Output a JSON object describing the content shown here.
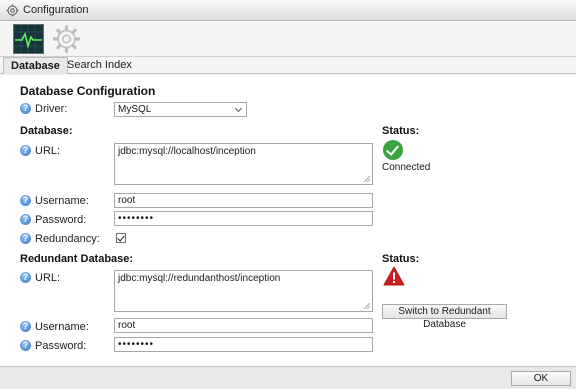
{
  "window": {
    "title": "Configuration"
  },
  "toolbar": {
    "buttons": [
      {
        "name": "monitor",
        "icon": "heartbeat-monitor-icon"
      },
      {
        "name": "settings",
        "icon": "gear-icon"
      }
    ]
  },
  "tabs": [
    {
      "label": "Database",
      "active": true
    },
    {
      "label": "Search Index",
      "active": false
    }
  ],
  "db_config": {
    "heading": "Database Configuration",
    "driver_label": "Driver:",
    "driver_value": "MySQL"
  },
  "primary": {
    "heading": "Database:",
    "url_label": "URL:",
    "url_value": "jdbc:mysql://localhost/inception",
    "username_label": "Username:",
    "username_value": "root",
    "password_label": "Password:",
    "password_value": "••••••••",
    "redundancy_label": "Redundancy:",
    "redundancy_checked": true,
    "status_label": "Status:",
    "status_text": "Connected",
    "status_color": "#3aa23e"
  },
  "redundant": {
    "heading": "Redundant Database:",
    "url_label": "URL:",
    "url_value": "jdbc:mysql://redundanthost/inception",
    "username_label": "Username:",
    "username_value": "root",
    "password_label": "Password:",
    "password_value": "••••••••",
    "status_label": "Status:",
    "status_color": "#cc1f1f",
    "switch_button": "Switch to Redundant Database"
  },
  "footer": {
    "ok_label": "OK"
  }
}
